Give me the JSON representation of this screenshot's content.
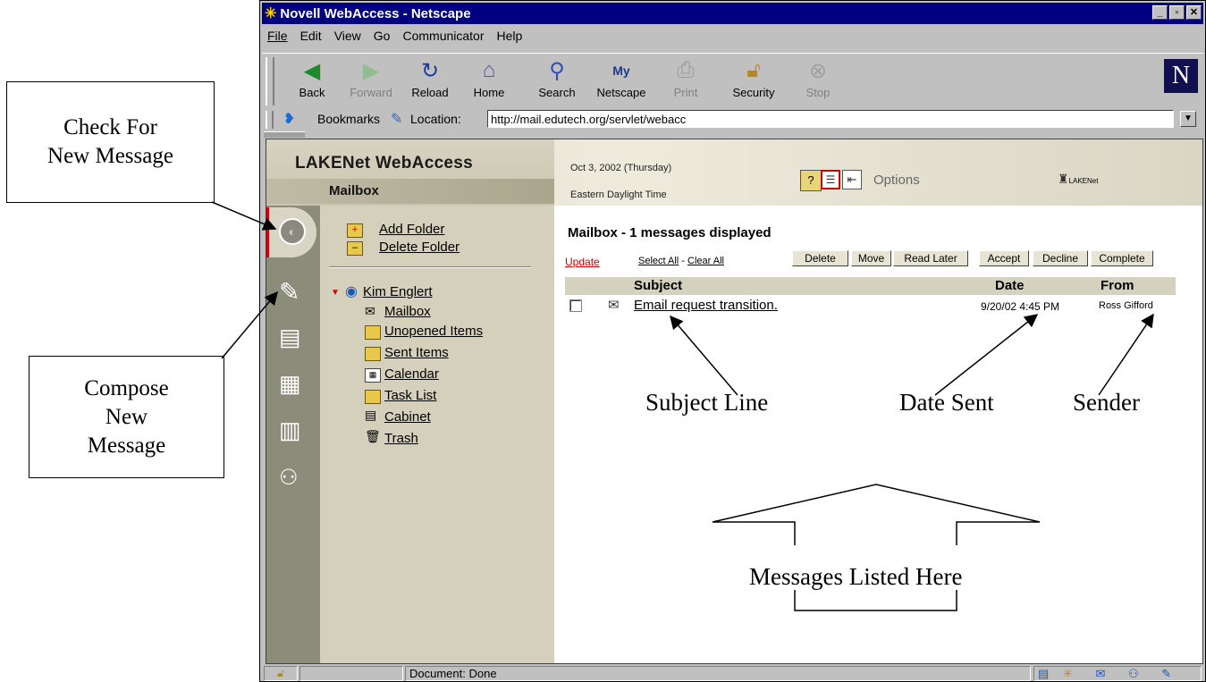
{
  "annotations": {
    "check_new": "Check For New Message",
    "compose_new": "Compose New Message",
    "subject_line": "Subject Line",
    "date_sent": "Date Sent",
    "sender": "Sender",
    "messages_listed": "Messages Listed Here"
  },
  "window": {
    "title": "Novell WebAccess - Netscape",
    "menu": [
      "File",
      "Edit",
      "View",
      "Go",
      "Communicator",
      "Help"
    ]
  },
  "toolbar": {
    "buttons": [
      {
        "label": "Back",
        "icon": "back-arrow-icon"
      },
      {
        "label": "Forward",
        "icon": "forward-arrow-icon"
      },
      {
        "label": "Reload",
        "icon": "reload-icon"
      },
      {
        "label": "Home",
        "icon": "home-icon"
      },
      {
        "label": "Search",
        "icon": "search-icon"
      },
      {
        "label": "Netscape",
        "icon": "netscape-icon"
      },
      {
        "label": "Print",
        "icon": "print-icon"
      },
      {
        "label": "Security",
        "icon": "lock-icon"
      },
      {
        "label": "Stop",
        "icon": "stop-icon"
      }
    ]
  },
  "location": {
    "bookmarks_label": "Bookmarks",
    "location_label": "Location:",
    "url": "http://mail.edutech.org/servlet/webacc"
  },
  "app": {
    "title": "LAKENet WebAccess",
    "section": "Mailbox",
    "date": "Oct 3, 2002 (Thursday)",
    "timezone": "Eastern Daylight Time",
    "options_label": "Options",
    "logo_text": "LAKENet"
  },
  "folders": {
    "add_folder": "Add Folder",
    "delete_folder": "Delete Folder",
    "user": "Kim Englert",
    "items": [
      "Mailbox",
      "Unopened Items",
      "Sent Items",
      "Calendar",
      "Task List",
      "Cabinet",
      "Trash"
    ]
  },
  "mailbox": {
    "heading": "Mailbox - 1 messages displayed",
    "update": "Update",
    "select_all": "Select All",
    "separator": " - ",
    "clear_all": "Clear All",
    "actions": [
      "Delete",
      "Move",
      "Read Later",
      "Accept",
      "Decline",
      "Complete"
    ],
    "columns": {
      "subject": "Subject",
      "date": "Date",
      "from": "From"
    },
    "messages": [
      {
        "subject": "Email request transition.",
        "date": "9/20/02 4:45 PM",
        "from": "Ross Gifford"
      }
    ]
  },
  "status": {
    "text": "Document: Done"
  }
}
